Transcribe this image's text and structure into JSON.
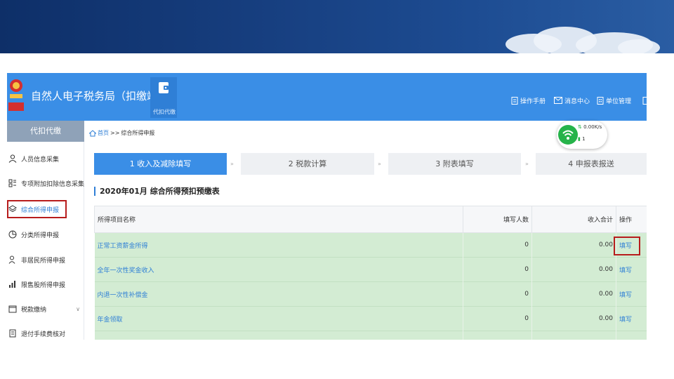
{
  "app": {
    "title": "自然人电子税务局（扣缴端）",
    "module_label": "代扣代缴",
    "top_links": [
      "操作手册",
      "消息中心",
      "单位管理"
    ]
  },
  "sidebar": {
    "header": "代扣代缴",
    "items": [
      {
        "label": "人员信息采集",
        "icon": "person-icon"
      },
      {
        "label": "专项附加扣除信息采集",
        "icon": "grid-icon"
      },
      {
        "label": "综合所得申报",
        "icon": "layers-icon",
        "active": true
      },
      {
        "label": "分类所得申报",
        "icon": "pie-icon"
      },
      {
        "label": "非居民所得申报",
        "icon": "person-outline-icon"
      },
      {
        "label": "限售股所得申报",
        "icon": "bar-chart-icon"
      },
      {
        "label": "税款缴纳",
        "icon": "folder-icon",
        "chevron": "∨"
      },
      {
        "label": "退付手续费核对",
        "icon": "document-icon"
      }
    ]
  },
  "breadcrumb": {
    "home": "首页",
    "separator": ">>",
    "current": "综合所得申报"
  },
  "steps": [
    {
      "label": "1 收入及减除填写",
      "active": true
    },
    {
      "label": "2 税款计算",
      "active": false
    },
    {
      "label": "3 附表填写",
      "active": false
    },
    {
      "label": "4 申报表报送",
      "active": false
    }
  ],
  "step_separator": "»",
  "section_title": "2020年01月  综合所得预扣预缴表",
  "table": {
    "columns": [
      "所得项目名称",
      "填写人数",
      "收入合计",
      "操作"
    ],
    "rows": [
      {
        "name": "正常工资薪金所得",
        "count": "0",
        "income": "0.00",
        "action": "填写"
      },
      {
        "name": "全年一次性奖金收入",
        "count": "0",
        "income": "0.00",
        "action": "填写"
      },
      {
        "name": "内退一次性补偿金",
        "count": "0",
        "income": "0.00",
        "action": "填写"
      },
      {
        "name": "年金领取",
        "count": "0",
        "income": "0.00",
        "action": "填写"
      }
    ]
  },
  "network": {
    "speed": "0.00K/s",
    "count": "1"
  },
  "colors": {
    "accent": "#3a8ee6",
    "highlight_box": "#b71c1c",
    "row_bg": "#d3ecd3"
  }
}
